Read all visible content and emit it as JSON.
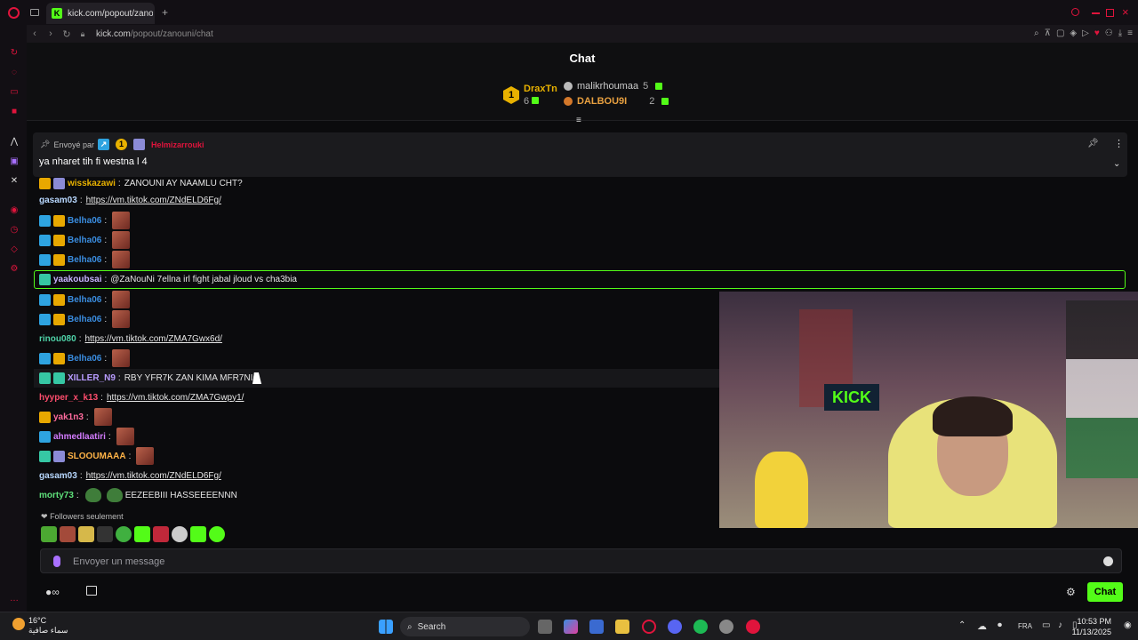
{
  "browser": {
    "tab_title": "kick.com/popout/zanouni",
    "url_host": "kick.com",
    "url_path": "/popout/zanouni/chat",
    "new_tab": "+"
  },
  "chat": {
    "title": "Chat",
    "gifters": [
      {
        "rank": "1",
        "name": "DraxTn",
        "count": "6"
      },
      {
        "rank": "",
        "name": "malikrhoumaa",
        "count": "5"
      },
      {
        "rank": "",
        "name": "DALBOU9I",
        "count": "2"
      }
    ],
    "pinned": {
      "by_label": "Envoyé par",
      "by_user": "Helmizarrouki",
      "message": "ya nharet tih fi westna l 4"
    },
    "messages": [
      {
        "user": "wisskazawi",
        "color": "#e8b100",
        "sep": ":",
        "text": "ZANOUNI AY NAAMLU CHT?"
      },
      {
        "user": "gasam03",
        "color": "#b8d8ff",
        "sep": ":",
        "link": "https://vm.tiktok.com/ZNdELD6Fg/"
      },
      {
        "user": "Belha06",
        "color": "#3a8de0",
        "sep": ":"
      },
      {
        "user": "Belha06",
        "color": "#3a8de0",
        "sep": ":"
      },
      {
        "user": "Belha06",
        "color": "#3a8de0",
        "sep": ":"
      },
      {
        "user": "yaakoubsai",
        "color": "#c7b3ff",
        "sep": ":",
        "text": "@ZaNouNi 7ellna irl fight jabal jloud vs cha3bia"
      },
      {
        "user": "Belha06",
        "color": "#3a8de0",
        "sep": ":"
      },
      {
        "user": "Belha06",
        "color": "#3a8de0",
        "sep": ":"
      },
      {
        "user": "rinou080",
        "color": "#4fd3a8",
        "sep": ":",
        "link": "https://vm.tiktok.com/ZMA7Gwx6d/"
      },
      {
        "user": "Belha06",
        "color": "#3a8de0",
        "sep": ":"
      },
      {
        "user": "XILLER_N9",
        "color": "#b89cff",
        "sep": ":",
        "text": "RBY YFR7K ZAN KIMA MFR7NI"
      },
      {
        "user": "hyyper_x_k13",
        "color": "#ff4d6d",
        "sep": ":",
        "link": "https://vm.tiktok.com/ZMA7Gwpy1/"
      },
      {
        "user": "yak1n3",
        "color": "#ff6b9d",
        "sep": ":"
      },
      {
        "user": "ahmedlaatiri",
        "color": "#d47cff",
        "sep": ":"
      },
      {
        "user": "SLOOUMAAA",
        "color": "#ffb347",
        "sep": ":"
      },
      {
        "user": "gasam03",
        "color": "#b8d8ff",
        "sep": ":",
        "link": "https://vm.tiktok.com/ZNdELD6Fg/"
      },
      {
        "user": "morty73",
        "color": "#5ee07a",
        "sep": ":",
        "text": "EEZEEBIII HASSEEEENNN"
      }
    ],
    "followers_only": "Followers seulement",
    "input_placeholder": "Envoyer un message",
    "send_label": "Chat"
  },
  "taskbar": {
    "weather_temp": "16°C",
    "weather_desc": "سماء صافية",
    "search_label": "Search",
    "lang": "FRA",
    "time": "10:53 PM",
    "date": "11/13/2025"
  },
  "colors": {
    "accent": "#53fc18",
    "background": "#0b0b0d"
  }
}
